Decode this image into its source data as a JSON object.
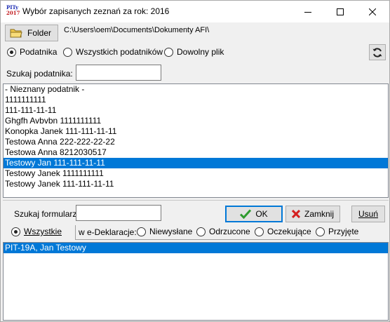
{
  "window": {
    "title": "Wybór zapisanych zeznań za rok: 2016",
    "app_icon_top": "PITy",
    "app_icon_year": "2017"
  },
  "folder": {
    "button_label": "Folder",
    "path": "C:\\Users\\oem\\Documents\\Dokumenty AFI\\"
  },
  "scope": {
    "options": [
      "Podatnika",
      "Wszystkich podatników",
      "Dowolny plik"
    ],
    "selected": "Podatnika"
  },
  "search_taxpayer": {
    "label": "Szukaj podatnika:",
    "value": ""
  },
  "taxpayers": {
    "items": [
      "- Nieznany podatnik -",
      "1111111111",
      "111-111-11-11",
      "Ghgfh Avbvbn 1111111111",
      "Konopka Janek 111-111-11-11",
      "Testowa Anna 222-222-22-22",
      "Testowa Anna 8212030517",
      "Testowy Jan 111-111-11-11",
      "Testowy Janek 1111111111",
      "Testowy Janek 111-111-11-11"
    ],
    "selected": "Testowy Jan 111-111-11-11"
  },
  "search_form": {
    "label": "Szukaj formularz:",
    "value": ""
  },
  "actions": {
    "ok": "OK",
    "close": "Zamknij",
    "delete": "Usuń"
  },
  "filter": {
    "all": "Wszystkie",
    "group_label": "w e-Deklaracje:",
    "options": [
      "Niewysłane",
      "Odrzucone",
      "Oczekujące",
      "Przyjęte"
    ],
    "selected": "Wszystkie"
  },
  "forms": {
    "items": [
      "PIT-19A, Jan Testowy"
    ],
    "selected": "PIT-19A, Jan Testowy"
  },
  "colors": {
    "selection": "#0078d7",
    "ok_check": "#2e9b2e",
    "close_x": "#d42020"
  }
}
